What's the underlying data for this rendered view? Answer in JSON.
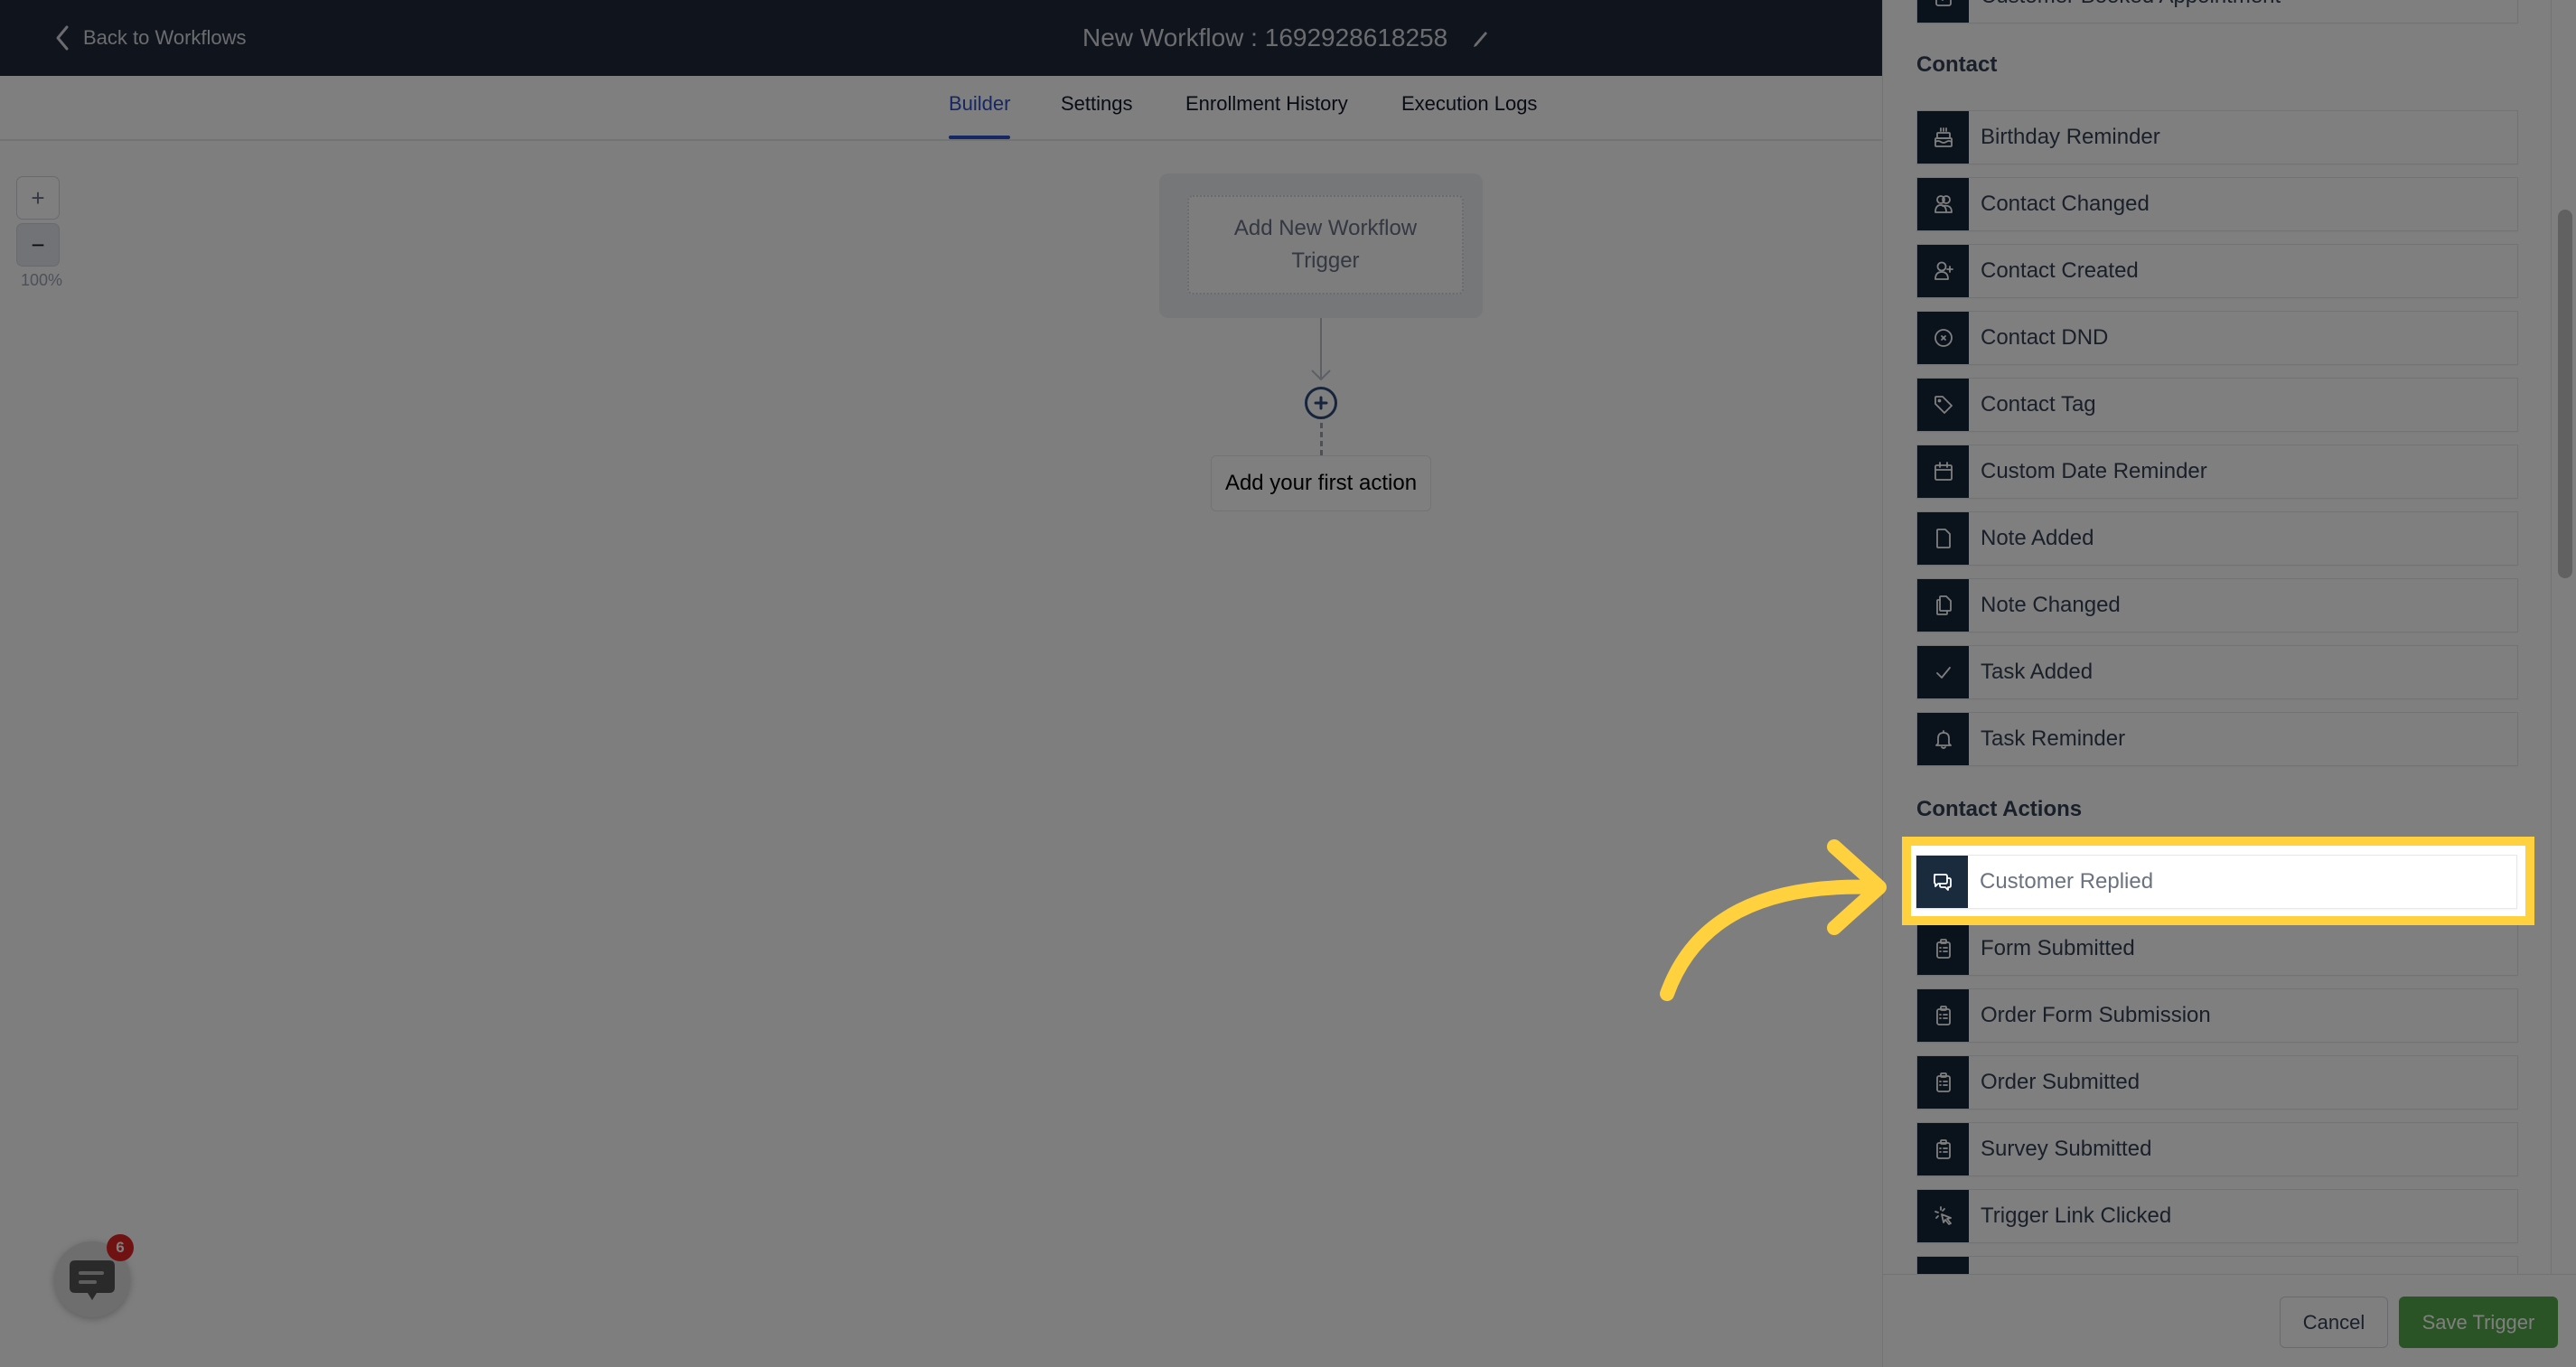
{
  "header": {
    "back_label": "Back to Workflows",
    "title": "New Workflow : 1692928618258"
  },
  "tabs": [
    {
      "label": "Builder",
      "active": true
    },
    {
      "label": "Settings",
      "active": false
    },
    {
      "label": "Enrollment History",
      "active": false
    },
    {
      "label": "Execution Logs",
      "active": false
    }
  ],
  "canvas": {
    "zoom_in": "+",
    "zoom_out": "−",
    "zoom_level": "100%",
    "trigger_placeholder": "Add New Workflow Trigger",
    "first_action_label": "Add your first action"
  },
  "chat_widget": {
    "badge_count": "6"
  },
  "panel": {
    "partial_top_item": "Customer Booked Appointment",
    "sections": [
      {
        "title": "Contact",
        "items": [
          {
            "label": "Birthday Reminder",
            "icon": "cake-icon"
          },
          {
            "label": "Contact Changed",
            "icon": "users-icon"
          },
          {
            "label": "Contact Created",
            "icon": "user-plus-icon"
          },
          {
            "label": "Contact DND",
            "icon": "x-circle-icon"
          },
          {
            "label": "Contact Tag",
            "icon": "tag-icon"
          },
          {
            "label": "Custom Date Reminder",
            "icon": "calendar-icon"
          },
          {
            "label": "Note Added",
            "icon": "file-icon"
          },
          {
            "label": "Note Changed",
            "icon": "files-icon"
          },
          {
            "label": "Task Added",
            "icon": "check-icon"
          },
          {
            "label": "Task Reminder",
            "icon": "bell-icon"
          }
        ]
      },
      {
        "title": "Contact Actions",
        "items": [
          {
            "label": "Customer Replied",
            "icon": "chat-bubbles-icon",
            "highlighted": true
          },
          {
            "label": "Form Submitted",
            "icon": "clipboard-icon"
          },
          {
            "label": "Order Form Submission",
            "icon": "clipboard-icon"
          },
          {
            "label": "Order Submitted",
            "icon": "clipboard-icon"
          },
          {
            "label": "Survey Submitted",
            "icon": "clipboard-icon"
          },
          {
            "label": "Trigger Link Clicked",
            "icon": "cursor-click-icon"
          }
        ]
      }
    ],
    "cancel_label": "Cancel",
    "save_label": "Save Trigger"
  },
  "colors": {
    "header_bg": "#202a3a",
    "tab_active": "#2f4fc6",
    "icon_tile": "#142438",
    "save_button": "#55a84a",
    "highlight": "#ffd13f",
    "badge": "#e02424"
  }
}
